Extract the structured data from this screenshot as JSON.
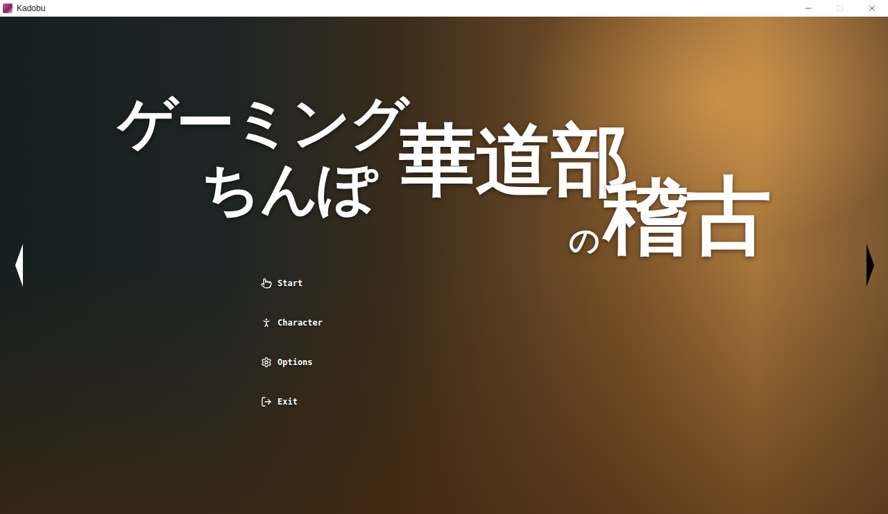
{
  "window": {
    "title": "Kadobu",
    "controls": [
      {
        "kind": "minimize",
        "disabled": false
      },
      {
        "kind": "maximize",
        "disabled": true
      },
      {
        "kind": "close",
        "disabled": false
      }
    ]
  },
  "logo": {
    "parts": [
      "ゲーミング",
      "ちんぽ",
      "華道部",
      "の",
      "稽古"
    ]
  },
  "menu": [
    {
      "label": "Start",
      "kind": "start"
    },
    {
      "label": "Character",
      "kind": "character"
    },
    {
      "label": "Options",
      "kind": "options"
    },
    {
      "label": "Exit",
      "kind": "exit"
    }
  ],
  "arrows": [
    {
      "direction": "left",
      "color": "#ffffff"
    },
    {
      "direction": "right",
      "color": "#000000"
    }
  ]
}
